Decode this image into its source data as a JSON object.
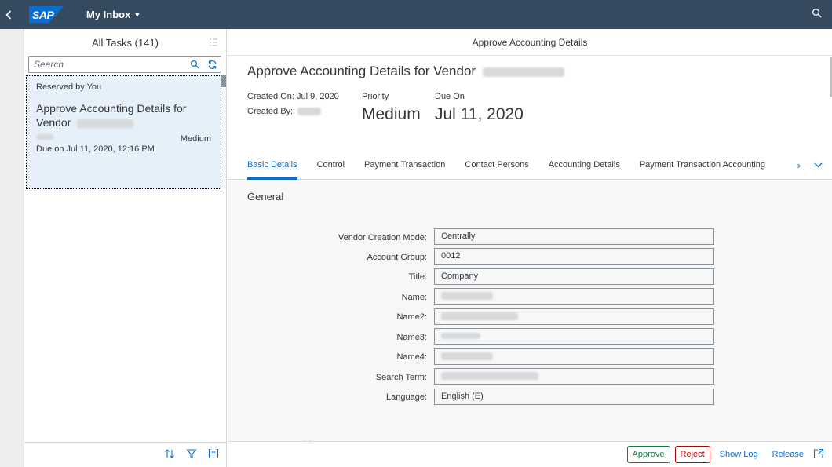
{
  "shell": {
    "logo": "SAP",
    "app_title": "My Inbox",
    "back_icon": "chevron-left-icon",
    "menu_icon": "caret-down-icon",
    "search_icon": "search-icon"
  },
  "master": {
    "header": "All Tasks (141)",
    "search_placeholder": "Search",
    "task": {
      "reserved": "Reserved by You",
      "title": "Approve Accounting Details for Vendor",
      "priority": "Medium",
      "due": "Due on Jul 11, 2020, 12:16 PM"
    }
  },
  "detail": {
    "header": "Approve Accounting Details",
    "object_title": "Approve Accounting Details for Vendor",
    "created_on": "Created On: Jul 9, 2020",
    "created_by": "Created By:",
    "priority_label": "Priority",
    "priority_value": "Medium",
    "due_label": "Due On",
    "due_value": "Jul 11, 2020",
    "tabs": [
      "Basic Details",
      "Control",
      "Payment Transaction",
      "Contact Persons",
      "Accounting Details",
      "Payment Transaction Accounting"
    ],
    "section_title": "General",
    "fields": [
      {
        "label": "Vendor Creation Mode:",
        "value": "Centrally"
      },
      {
        "label": "Account Group:",
        "value": "0012"
      },
      {
        "label": "Title:",
        "value": "Company"
      },
      {
        "label": "Name:",
        "value": ""
      },
      {
        "label": "Name2:",
        "value": ""
      },
      {
        "label": "Name3:",
        "value": ""
      },
      {
        "label": "Name4:",
        "value": ""
      },
      {
        "label": "Search Term:",
        "value": ""
      },
      {
        "label": "Language:",
        "value": "English (E)"
      }
    ],
    "section2_title": "Company Address"
  },
  "footer": {
    "approve": "Approve",
    "reject": "Reject",
    "show_log": "Show Log",
    "release": "Release"
  },
  "colors": {
    "shell": "#354a5f",
    "accent": "#0a6ed1",
    "selected_card": "#e5f0fa",
    "approve": "#107e3e",
    "reject": "#bb0000"
  }
}
